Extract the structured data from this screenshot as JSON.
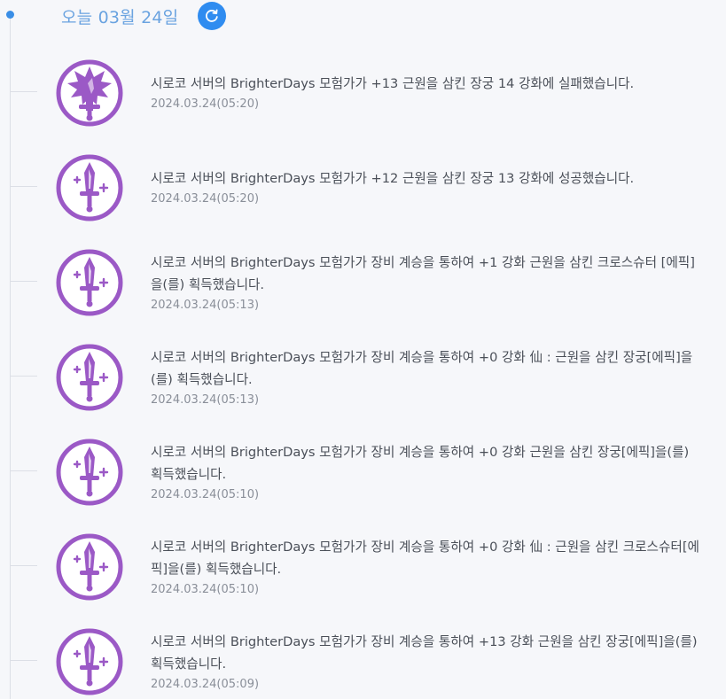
{
  "header": {
    "day_label": "오늘 03월 24일",
    "refresh_icon": "refresh-icon"
  },
  "colors": {
    "accent": "#2f8cf0",
    "icon_purple": "#9b59c6",
    "text": "#4a4f58",
    "time": "#8a8f99"
  },
  "entries": [
    {
      "icon": "broken-sword-icon",
      "message": "시로코 서버의 BrighterDays 모험가가 +13 근원을 삼킨 장궁 14 강화에 실패했습니다.",
      "time": "2024.03.24(05:20)"
    },
    {
      "icon": "sword-plus-icon",
      "message": "시로코 서버의 BrighterDays 모험가가 +12 근원을 삼킨 장궁 13 강화에 성공했습니다.",
      "time": "2024.03.24(05:20)"
    },
    {
      "icon": "sword-plus-icon",
      "message": "시로코 서버의 BrighterDays 모험가가 장비 계승을 통하여 +1 강화 근원을 삼킨 크로스슈터 [에픽]을(를) 획득했습니다.",
      "time": "2024.03.24(05:13)"
    },
    {
      "icon": "sword-plus-icon",
      "message": "시로코 서버의 BrighterDays 모험가가 장비 계승을 통하여 +0 강화 仙 : 근원을 삼킨 장궁[에픽]을(를) 획득했습니다.",
      "time": "2024.03.24(05:13)"
    },
    {
      "icon": "sword-plus-icon",
      "message": "시로코 서버의 BrighterDays 모험가가 장비 계승을 통하여 +0 강화 근원을 삼킨 장궁[에픽]을(를) 획득했습니다.",
      "time": "2024.03.24(05:10)"
    },
    {
      "icon": "sword-plus-icon",
      "message": "시로코 서버의 BrighterDays 모험가가 장비 계승을 통하여 +0 강화 仙 : 근원을 삼킨 크로스슈터[에픽]을(를) 획득했습니다.",
      "time": "2024.03.24(05:10)"
    },
    {
      "icon": "sword-plus-icon",
      "message": "시로코 서버의 BrighterDays 모험가가 장비 계승을 통하여 +13 강화 근원을 삼킨 장궁[에픽]을(를) 획득했습니다.",
      "time": "2024.03.24(05:09)"
    }
  ]
}
